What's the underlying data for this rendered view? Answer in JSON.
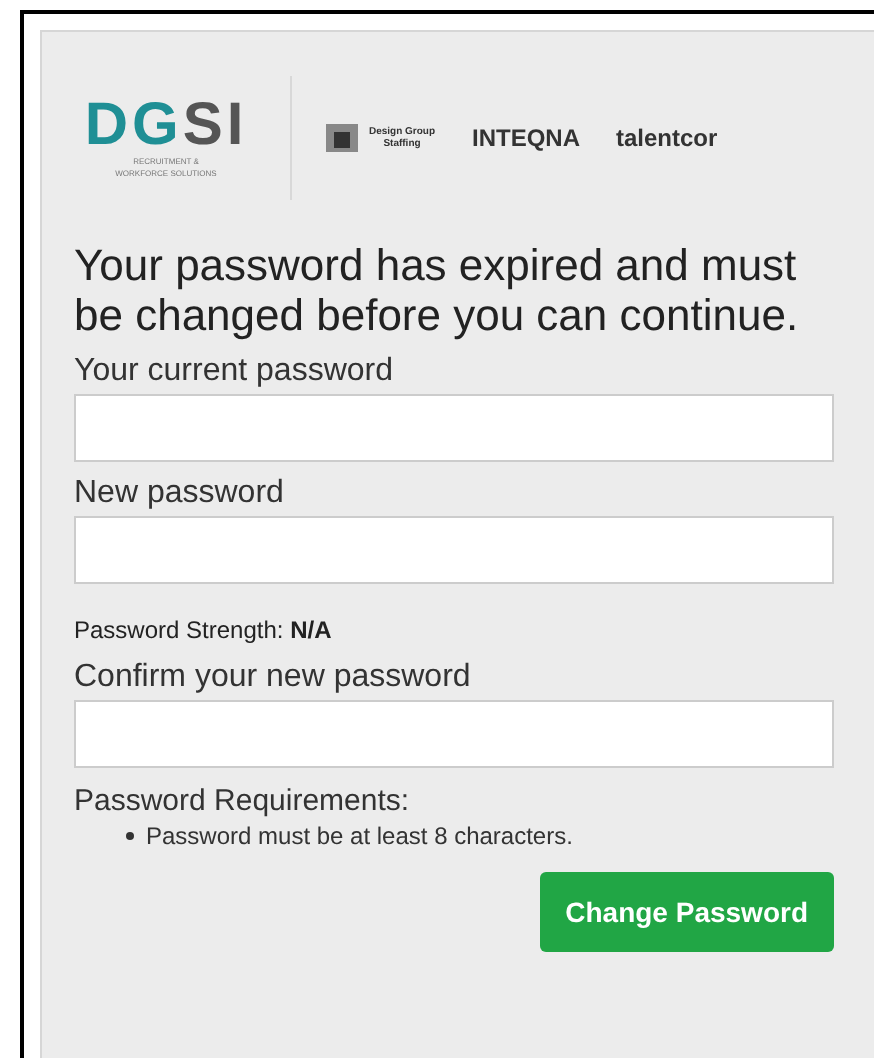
{
  "logos": {
    "main": {
      "letters": "DGSI",
      "tagline": "RECRUITMENT & WORKFORCE SOLUTIONS"
    },
    "brands": [
      {
        "kind": "mark",
        "text": "Design Group Staffing"
      },
      {
        "kind": "word",
        "text": "INTEQNA"
      },
      {
        "kind": "word",
        "text": "talentcor"
      }
    ]
  },
  "heading": "Your password has expired and must be changed before you can continue.",
  "fields": [
    {
      "label": "Your current password",
      "kind": "plain"
    },
    {
      "label": "New password",
      "kind": "strength",
      "strength_label": "Password Strength:",
      "strength_value": "N/A"
    },
    {
      "label": "Confirm your new password",
      "kind": "plain"
    }
  ],
  "requirements": {
    "title": "Password Requirements:",
    "items": [
      "Password must be at least 8 characters."
    ]
  },
  "submit": "Change Password"
}
